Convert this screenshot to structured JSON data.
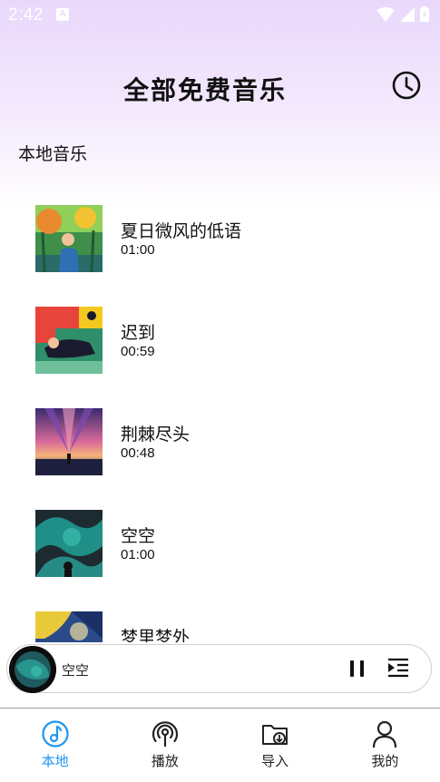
{
  "status_bar": {
    "time": "2:42",
    "notification_letter": "A"
  },
  "header": {
    "title": "全部免费音乐",
    "history_icon": "clock-icon"
  },
  "section": {
    "title": "本地音乐"
  },
  "songs": [
    {
      "title": "夏日微风的低语",
      "duration": "01:00"
    },
    {
      "title": "迟到",
      "duration": "00:59"
    },
    {
      "title": "荆棘尽头",
      "duration": "00:48"
    },
    {
      "title": "空空",
      "duration": "01:00"
    },
    {
      "title": "梦里梦外",
      "duration": ""
    }
  ],
  "player": {
    "title": "空空",
    "state_icon": "pause-icon",
    "playlist_icon": "playlist-icon"
  },
  "nav": {
    "items": [
      {
        "label": "本地",
        "icon": "music-note-icon",
        "active": true
      },
      {
        "label": "播放",
        "icon": "broadcast-icon",
        "active": false
      },
      {
        "label": "导入",
        "icon": "folder-download-icon",
        "active": false
      },
      {
        "label": "我的",
        "icon": "person-icon",
        "active": false
      }
    ]
  },
  "colors": {
    "accent": "#1e96f0",
    "header_gradient_top": "#e9d8fb",
    "text": "#111111"
  }
}
